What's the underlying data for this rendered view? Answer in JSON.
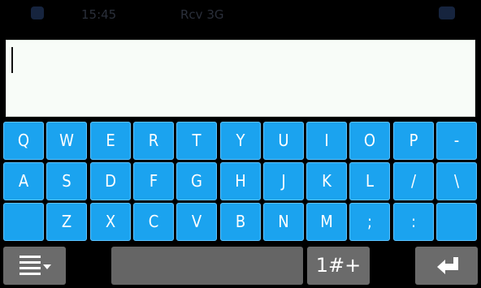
{
  "status_bar": {
    "time": "15:45",
    "network": "Rcv 3G",
    "colors": {
      "text": "#2a2f3a",
      "blob": "#16243e"
    }
  },
  "text_field": {
    "value": "",
    "placeholder": ""
  },
  "keyboard": {
    "key_color": "#1ba3ef",
    "rows": [
      [
        "Q",
        "W",
        "E",
        "R",
        "T",
        "Y",
        "U",
        "I",
        "O",
        "P",
        "-"
      ],
      [
        "A",
        "S",
        "D",
        "F",
        "G",
        "H",
        "J",
        "K",
        "L",
        "/",
        "\\"
      ],
      [
        "",
        "Z",
        "X",
        "C",
        "V",
        "B",
        "N",
        "M",
        ";",
        ":",
        ""
      ]
    ],
    "bottom": {
      "menu_icon": "menu-lines-icon",
      "symbols_label": "1#+",
      "enter_icon": "enter-icon"
    }
  }
}
